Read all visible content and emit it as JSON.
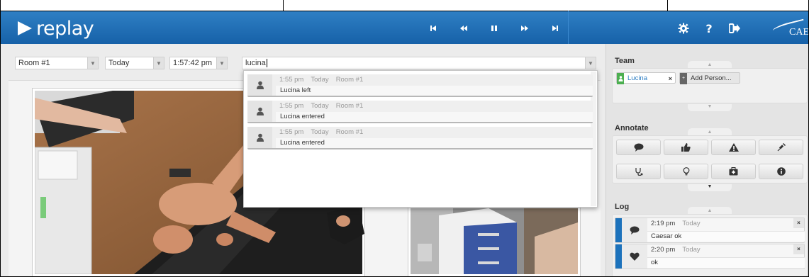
{
  "app": {
    "name": "replay",
    "vendor": "CAE"
  },
  "transport": {
    "skip_back": "⏮",
    "rewind": "⏪",
    "pause": "⏸",
    "forward": "⏩",
    "skip_forward": "⏭"
  },
  "filters": {
    "room": "Room #1",
    "day": "Today",
    "time": "1:57:42 pm",
    "search_value": "lucina"
  },
  "search_results": [
    {
      "time": "1:55 pm",
      "day": "Today",
      "room": "Room #1",
      "message": "Lucina left"
    },
    {
      "time": "1:55 pm",
      "day": "Today",
      "room": "Room #1",
      "message": "Lucina entered"
    },
    {
      "time": "1:55 pm",
      "day": "Today",
      "room": "Room #1",
      "message": "Lucina entered"
    }
  ],
  "team": {
    "heading": "Team",
    "members": [
      {
        "name": "Lucina",
        "remove": "×"
      }
    ],
    "add_label": "Add Person..."
  },
  "annotate": {
    "heading": "Annotate"
  },
  "log": {
    "heading": "Log",
    "entries": [
      {
        "time": "2:19 pm",
        "day": "Today",
        "message": "Caesar ok",
        "remove": "×"
      },
      {
        "time": "2:20 pm",
        "day": "Today",
        "message": "ok",
        "remove": "×"
      }
    ]
  },
  "colors": {
    "header_blue": "#1f6fb8",
    "accent_blue": "#1c72bc",
    "team_chip_green": "#4caf50"
  }
}
